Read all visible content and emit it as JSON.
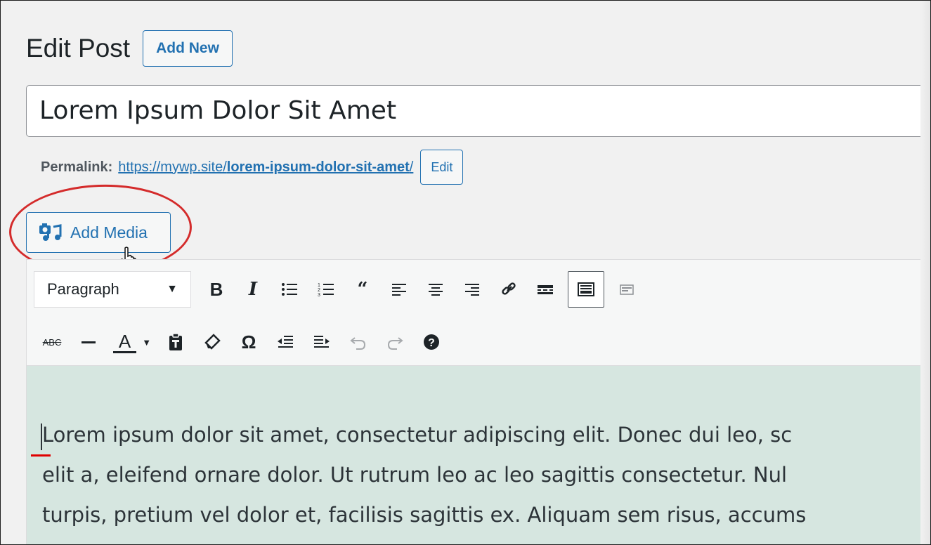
{
  "header": {
    "title": "Edit Post",
    "add_new_label": "Add New"
  },
  "post": {
    "title_value": "Lorem Ipsum Dolor Sit Amet"
  },
  "permalink": {
    "label": "Permalink:",
    "base_url": "https://mywp.site/",
    "slug": "lorem-ipsum-dolor-sit-amet",
    "trailing": "/",
    "edit_label": "Edit"
  },
  "media": {
    "add_media_label": "Add Media"
  },
  "toolbar": {
    "format_selected": "Paragraph",
    "row1": [
      "bold",
      "italic",
      "bulleted-list",
      "numbered-list",
      "blockquote",
      "align-left",
      "align-center",
      "align-right",
      "insert-link",
      "read-more",
      "toolbar-toggle",
      "distraction-free"
    ],
    "row2": [
      "strikethrough",
      "horizontal-line",
      "text-color",
      "paste-as-text",
      "clear-formatting",
      "special-character",
      "decrease-indent",
      "increase-indent",
      "undo",
      "redo",
      "keyboard-shortcuts"
    ],
    "strikethrough_label": "ABC",
    "text_color_label": "A",
    "colors": {
      "accent": "#2271b1",
      "text_color_underline": "#1d2327"
    }
  },
  "content": {
    "lines": [
      "Lorem ipsum dolor sit amet, consectetur adipiscing elit. Donec dui leo, sc",
      "elit a, eleifend ornare dolor. Ut rutrum leo ac leo sagittis consectetur. Nul",
      "turpis, pretium vel dolor et, facilisis sagittis ex. Aliquam sem risus, accums"
    ]
  },
  "annotation": {
    "highlight_color": "#d42b2b"
  }
}
